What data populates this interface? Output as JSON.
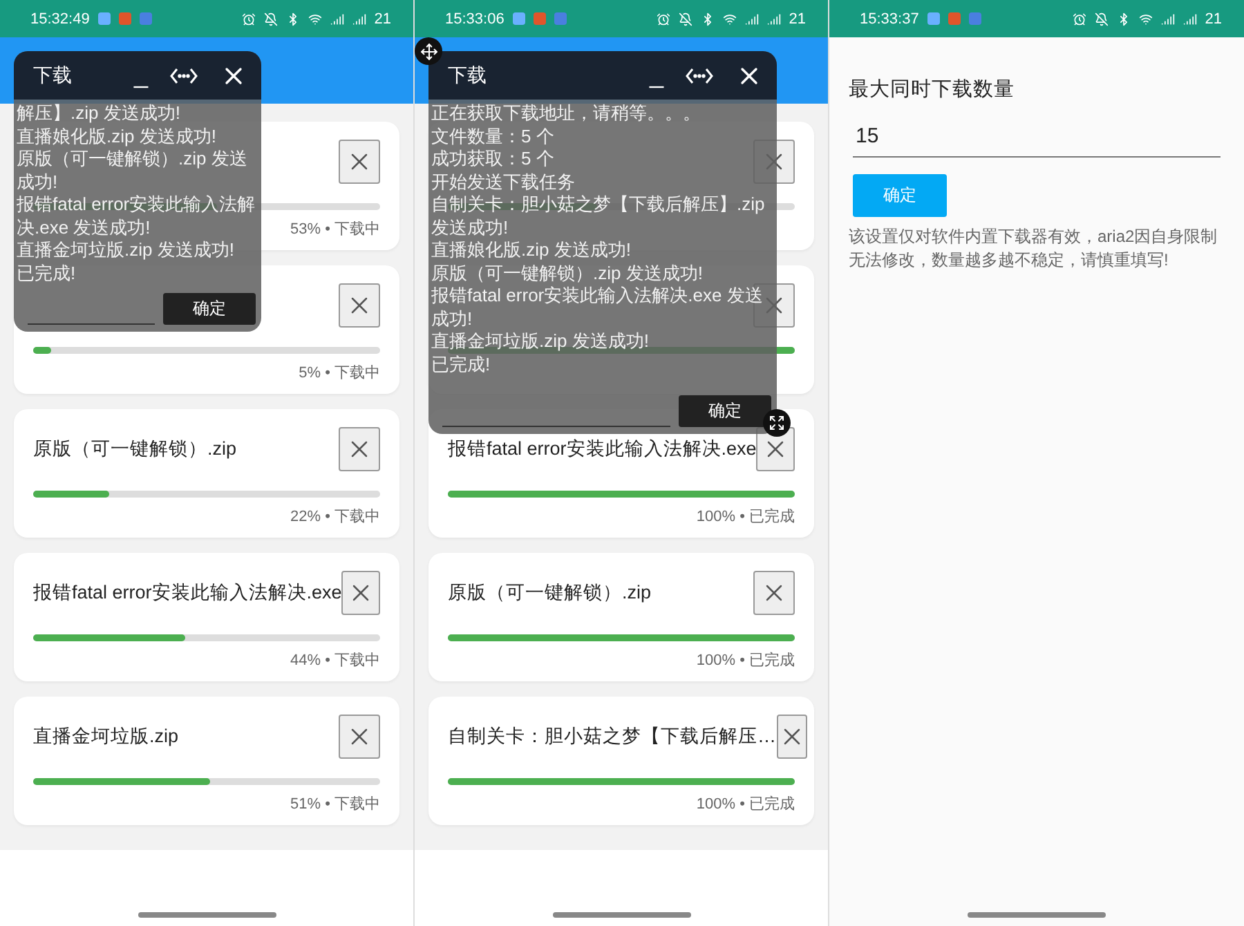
{
  "screens": [
    {
      "kind": "tasks",
      "status_bar": {
        "time": "15:32:49",
        "battery": "21"
      },
      "tasks": [
        {
          "level": 0.53,
          "reading": "53% • 下载中"
        },
        {
          "level": 0.05,
          "reading": "5% • 下载中"
        },
        {
          "name": "原版（可一键解锁）.zip",
          "level": 0.22,
          "reading": "22% • 下载中"
        },
        {
          "name": "报错fatal error安装此输入法解决.exe",
          "level": 0.44,
          "reading": "44% • 下载中"
        },
        {
          "name": "直播金坷垃版.zip",
          "level": 0.51,
          "reading": "51% • 下载中"
        }
      ],
      "dialog": {
        "kind": "compact",
        "title": "下载",
        "minimize": "_",
        "handles_visible": false,
        "confirm": "确定",
        "log": [
          "解压】.zip 发送成功!",
          "直播娘化版.zip 发送成功!",
          "原版（可一键解锁）.zip 发送成功!",
          "报错fatal error安装此输入法解决.exe 发送成功!",
          "直播金坷垃版.zip 发送成功!",
          "已完成!"
        ]
      }
    },
    {
      "kind": "tasks",
      "status_bar": {
        "time": "15:33:06",
        "battery": "21"
      },
      "tasks": [
        {
          "level": 0.43
        },
        {
          "level": 1
        },
        {
          "name": "报错fatal error安装此输入法解决.exe",
          "level": 1,
          "reading": "100% • 已完成"
        },
        {
          "name": "原版（可一键解锁）.zip",
          "level": 1,
          "reading": "100% • 已完成"
        },
        {
          "name": "自制关卡：胆小菇之梦【下载后解压…",
          "level": 1,
          "reading": "100% • 已完成"
        }
      ],
      "dialog": {
        "kind": "wide",
        "title": "下载",
        "minimize": "_",
        "handles_visible": true,
        "confirm": "确定",
        "log": [
          "正在获取下载地址，请稍等。。。",
          "文件数量：5 个",
          "成功获取：5 个",
          "开始发送下载任务",
          "自制关卡：胆小菇之梦【下载后解压】.zip 发送成功!",
          "直播娘化版.zip 发送成功!",
          "原版（可一键解锁）.zip 发送成功!",
          "报错fatal error安装此输入法解决.exe 发送成功!",
          "直播金坷垃版.zip 发送成功!",
          "已完成!"
        ]
      }
    },
    {
      "kind": "settings",
      "status_bar": {
        "time": "15:33:37",
        "battery": "21"
      },
      "label": "最大同时下载数量",
      "input": {
        "value": "15"
      },
      "button": "确定",
      "note": "该设置仅对软件内置下载器有效，aria2因自身限制无法修改，数量越多越不稳定，请慎重填写!"
    }
  ]
}
